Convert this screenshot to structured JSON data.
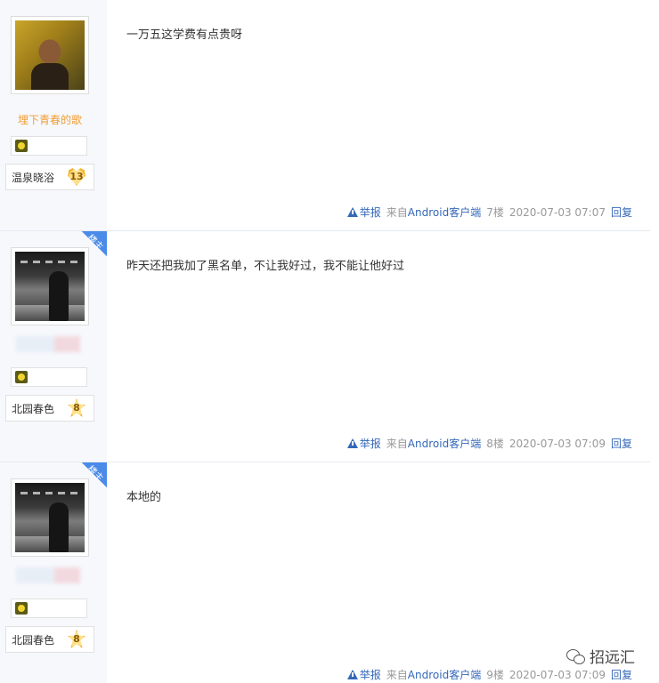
{
  "posts": [
    {
      "username": "埋下青春的歌",
      "group": "温泉晓浴",
      "level": "13",
      "is_op": false,
      "op_label": "",
      "content": "一万五这学费有点贵呀",
      "report": "举报",
      "source_prefix": "来自",
      "source_app": "Android客户端",
      "floor": "7楼",
      "time": "2020-07-03 07:07",
      "reply": "回复"
    },
    {
      "username": "",
      "group": "北园春色",
      "level": "8",
      "is_op": true,
      "op_label": "楼主",
      "content": "昨天还把我加了黑名单，不让我好过，我不能让他好过",
      "report": "举报",
      "source_prefix": "来自",
      "source_app": "Android客户端",
      "floor": "8楼",
      "time": "2020-07-03 07:09",
      "reply": "回复"
    },
    {
      "username": "",
      "group": "北园春色",
      "level": "8",
      "is_op": true,
      "op_label": "楼主",
      "content": "本地的",
      "report": "举报",
      "source_prefix": "来自",
      "source_app": "Android客户端",
      "floor": "9楼",
      "time": "2020-07-03 07:09",
      "reply": "回复"
    }
  ],
  "watermark": "招远汇",
  "icons": {
    "report": "warning-triangle-icon",
    "watermark": "wechat-icon"
  },
  "colors": {
    "link": "#3468b8",
    "username": "#f39c34",
    "op_ribbon": "#4a8ae8",
    "sidebar_bg": "#f6f8fc"
  }
}
